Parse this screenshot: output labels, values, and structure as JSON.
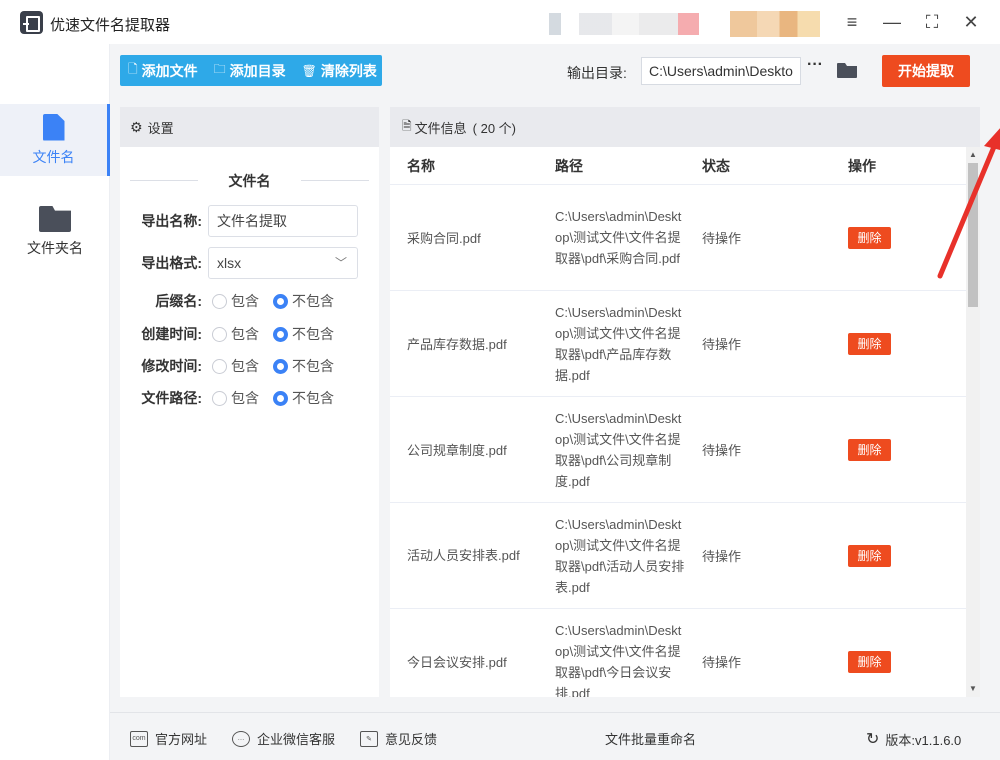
{
  "app": {
    "title": "优速文件名提取器"
  },
  "sidebar": {
    "items": [
      {
        "label": "文件名"
      },
      {
        "label": "文件夹名"
      }
    ]
  },
  "toolbar": {
    "add_file": "添加文件",
    "add_dir": "添加目录",
    "clear_list": "清除列表",
    "output_label": "输出目录:",
    "output_value": "C:\\Users\\admin\\Deskto",
    "dots": "···",
    "start": "开始提取"
  },
  "settings": {
    "header": "设置",
    "section": "文件名",
    "export_name_label": "导出名称:",
    "export_name_value": "文件名提取",
    "export_format_label": "导出格式:",
    "export_format_value": "xlsx",
    "include": "包含",
    "exclude": "不包含",
    "rows": [
      {
        "label": "后缀名:"
      },
      {
        "label": "创建时间:"
      },
      {
        "label": "修改时间:"
      },
      {
        "label": "文件路径:"
      }
    ]
  },
  "files": {
    "header": "文件信息",
    "count": "( 20 个)",
    "columns": [
      "名称",
      "路径",
      "状态",
      "操作"
    ],
    "rows": [
      {
        "name": "采购合同.pdf",
        "path": "C:\\Users\\admin\\Desktop\\测试文件\\文件名提取器\\pdf\\采购合同.pdf",
        "status": "待操作",
        "action": "删除"
      },
      {
        "name": "产品库存数据.pdf",
        "path": "C:\\Users\\admin\\Desktop\\测试文件\\文件名提取器\\pdf\\产品库存数据.pdf",
        "status": "待操作",
        "action": "删除"
      },
      {
        "name": "公司规章制度.pdf",
        "path": "C:\\Users\\admin\\Desktop\\测试文件\\文件名提取器\\pdf\\公司规章制度.pdf",
        "status": "待操作",
        "action": "删除"
      },
      {
        "name": "活动人员安排表.pdf",
        "path": "C:\\Users\\admin\\Desktop\\测试文件\\文件名提取器\\pdf\\活动人员安排表.pdf",
        "status": "待操作",
        "action": "删除"
      },
      {
        "name": "今日会议安排.pdf",
        "path": "C:\\Users\\admin\\Desktop\\测试文件\\文件名提取器\\pdf\\今日会议安排.pdf",
        "status": "待操作",
        "action": "删除"
      }
    ]
  },
  "footer": {
    "website": "官方网址",
    "wechat": "企业微信客服",
    "feedback": "意见反馈",
    "rename": "文件批量重命名",
    "version": "版本:v1.1.6.0"
  },
  "colors": {
    "accent": "#3b82f6",
    "toolbar": "#2ea9e8",
    "danger": "#ee4b1f"
  }
}
